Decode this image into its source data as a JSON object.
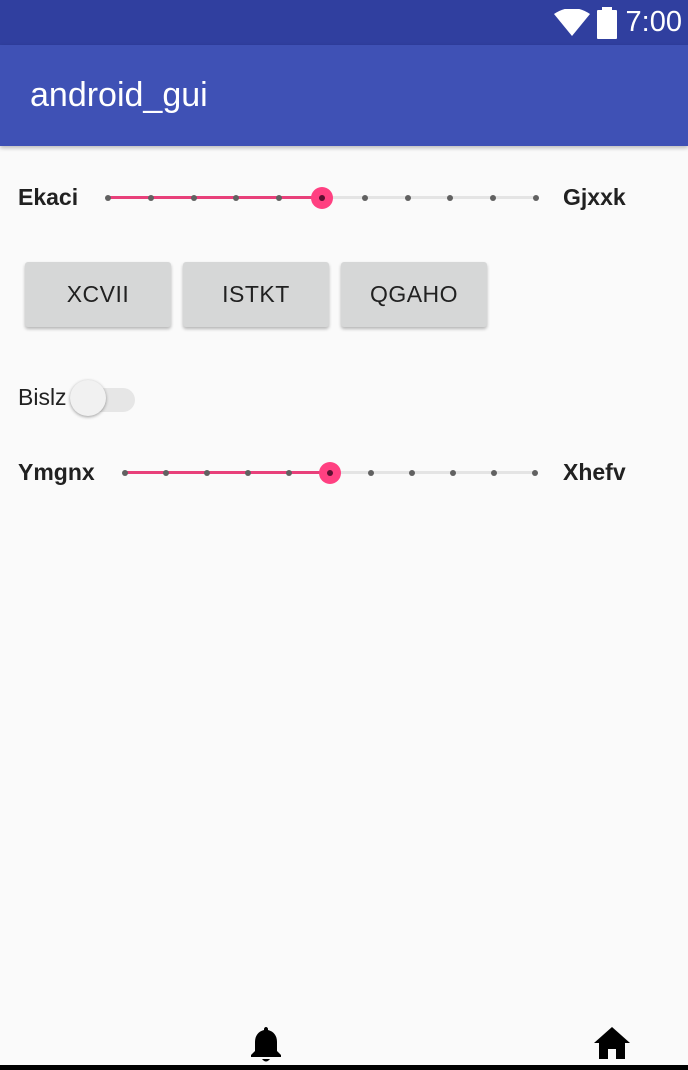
{
  "status_bar": {
    "time": "7:00",
    "icons": [
      "wifi-icon",
      "battery-icon"
    ],
    "background": "#303F9F"
  },
  "app_bar": {
    "title": "android_gui",
    "background": "#3F51B5"
  },
  "colors": {
    "accent": "#FF4081",
    "slider_active": "#E8407A",
    "button_bg": "#D6D7D7",
    "page_bg": "#FAFAFA"
  },
  "slider1": {
    "left_label": "Ekaci",
    "right_label": "Gjxxk",
    "steps": 10,
    "value": 5
  },
  "buttons": [
    "XCVII",
    "ISTKT",
    "QGAHO"
  ],
  "switch": {
    "label": "Bislz",
    "checked": false
  },
  "slider2": {
    "left_label": "Ymgnx",
    "right_label": "Xhefv",
    "steps": 10,
    "value": 5
  },
  "bottom_nav": {
    "icons": [
      "bell-icon",
      "home-icon"
    ]
  }
}
